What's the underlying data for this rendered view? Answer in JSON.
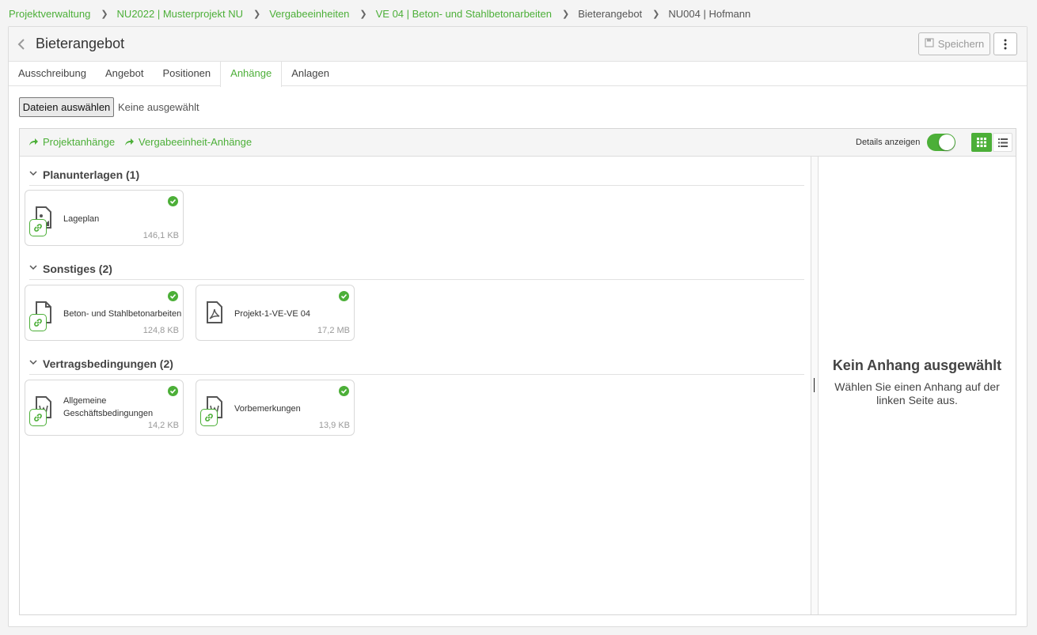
{
  "breadcrumb": {
    "items": [
      "Projektverwaltung",
      "NU2022 | Musterprojekt NU",
      "Vergabeeinheiten",
      "VE 04 | Beton- und Stahlbetonarbeiten"
    ],
    "current1": "Bieterangebot",
    "current2": "NU004 | Hofmann"
  },
  "header": {
    "title": "Bieterangebot",
    "save_label": "Speichern"
  },
  "tabs": [
    "Ausschreibung",
    "Angebot",
    "Positionen",
    "Anhänge",
    "Anlagen"
  ],
  "active_tab": "Anhänge",
  "upload": {
    "button_label": "Dateien auswählen",
    "status": "Keine ausgewählt"
  },
  "toolbar": {
    "link1": "Projektanhänge",
    "link2": "Vergabeeinheit-Anhänge",
    "details_label": "Details anzeigen",
    "details_on": true
  },
  "groups": [
    {
      "title": "Planunterlagen (1)",
      "files": [
        {
          "name": "Lageplan",
          "size": "146,1 KB",
          "icon": "image-file-icon",
          "linked": true
        }
      ]
    },
    {
      "title": "Sonstiges (2)",
      "files": [
        {
          "name": "Beton- und Stahlbetonarbeiten",
          "size": "124,8 KB",
          "icon": "file-icon",
          "linked": true
        },
        {
          "name": "Projekt-1-VE-VE 04",
          "size": "17,2 MB",
          "icon": "pdf-file-icon",
          "linked": false
        }
      ]
    },
    {
      "title": "Vertragsbedingungen (2)",
      "files": [
        {
          "name": "Allgemeine Geschäftsbedingungen",
          "size": "14,2 KB",
          "icon": "word-file-icon",
          "linked": true
        },
        {
          "name": "Vorbemerkungen",
          "size": "13,9 KB",
          "icon": "word-file-icon",
          "linked": true
        }
      ]
    }
  ],
  "detail": {
    "title": "Kein Anhang ausgewählt",
    "text": "Wählen Sie einen Anhang auf der linken Seite aus."
  },
  "colors": {
    "accent": "#4caf38",
    "text": "#333333",
    "muted": "#999999"
  }
}
